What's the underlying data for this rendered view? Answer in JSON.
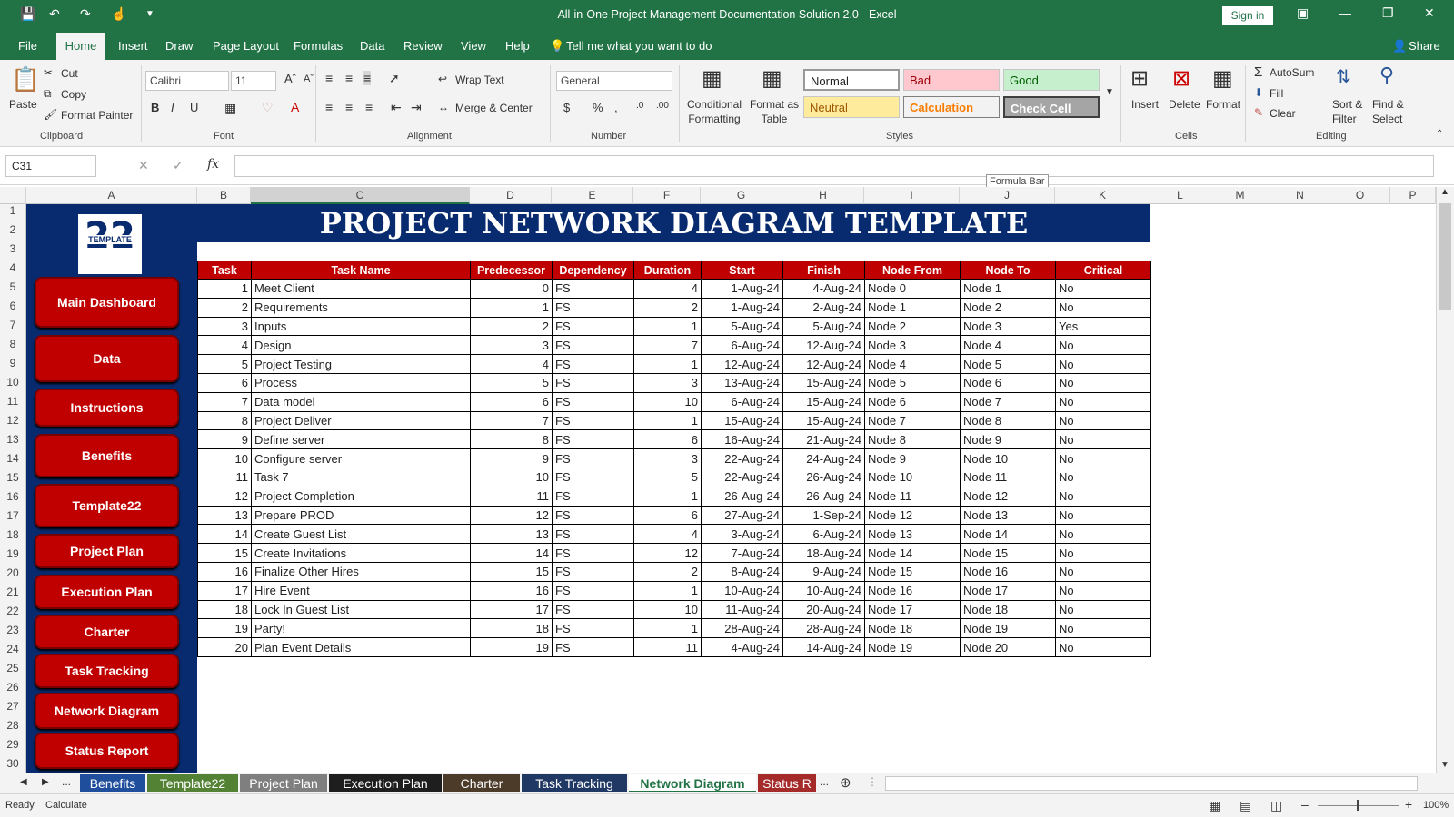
{
  "window": {
    "title": "All-in-One Project Management Documentation Solution 2.0  -  Excel",
    "sign_in": "Sign in"
  },
  "menu": {
    "tabs": [
      "File",
      "Home",
      "Insert",
      "Draw",
      "Page Layout",
      "Formulas",
      "Data",
      "Review",
      "View",
      "Help"
    ],
    "tell_me": "Tell me what you want to do",
    "share": "Share"
  },
  "ribbon": {
    "clipboard": {
      "paste": "Paste",
      "cut": "Cut",
      "copy": "Copy",
      "format_painter": "Format Painter",
      "label": "Clipboard"
    },
    "font": {
      "name": "Calibri",
      "size": "11",
      "label": "Font"
    },
    "alignment": {
      "wrap": "Wrap Text",
      "merge": "Merge & Center",
      "label": "Alignment"
    },
    "number": {
      "format": "General",
      "label": "Number"
    },
    "styles": {
      "conditional": "Conditional Formatting",
      "format_table": "Format as Table",
      "normal": "Normal",
      "bad": "Bad",
      "good": "Good",
      "neutral": "Neutral",
      "calculation": "Calculation",
      "check_cell": "Check Cell",
      "label": "Styles"
    },
    "cells": {
      "insert": "Insert",
      "delete": "Delete",
      "format": "Format",
      "label": "Cells"
    },
    "editing": {
      "autosum": "AutoSum",
      "fill": "Fill",
      "clear": "Clear",
      "sort": "Sort & Filter",
      "find": "Find & Select",
      "label": "Editing"
    }
  },
  "formula_bar": {
    "name_box": "C31",
    "tooltip": "Formula Bar"
  },
  "columns": [
    "A",
    "B",
    "C",
    "D",
    "E",
    "F",
    "G",
    "H",
    "I",
    "J",
    "K",
    "L",
    "M",
    "N",
    "O",
    "P"
  ],
  "rows": [
    "1",
    "2",
    "3",
    "4",
    "5",
    "6",
    "7",
    "8",
    "9",
    "10",
    "11",
    "12",
    "13",
    "14",
    "15",
    "16",
    "17",
    "18",
    "19",
    "20",
    "21",
    "22",
    "23",
    "24",
    "25",
    "26",
    "27",
    "28",
    "29",
    "30"
  ],
  "logo": {
    "number": "22",
    "text": "TEMPLATE"
  },
  "nav": [
    "Main Dashboard",
    "Data",
    "Instructions",
    "Benefits",
    "Template22",
    "Project Plan",
    "Execution Plan",
    "Charter",
    "Task Tracking",
    "Network Diagram",
    "Status Report"
  ],
  "banner": "PROJECT NETWORK DIAGRAM TEMPLATE",
  "table": {
    "headers": [
      "Task",
      "Task Name",
      "Predecessor",
      "Dependency",
      "Duration",
      "Start",
      "Finish",
      "Node From",
      "Node To",
      "Critical"
    ],
    "rows": [
      [
        "1",
        "Meet Client",
        "0",
        "FS",
        "4",
        "1-Aug-24",
        "4-Aug-24",
        "Node 0",
        "Node 1",
        "No"
      ],
      [
        "2",
        "Requirements",
        "1",
        "FS",
        "2",
        "1-Aug-24",
        "2-Aug-24",
        "Node 1",
        "Node 2",
        "No"
      ],
      [
        "3",
        "Inputs",
        "2",
        "FS",
        "1",
        "5-Aug-24",
        "5-Aug-24",
        "Node 2",
        "Node 3",
        "Yes"
      ],
      [
        "4",
        "Design",
        "3",
        "FS",
        "7",
        "6-Aug-24",
        "12-Aug-24",
        "Node 3",
        "Node 4",
        "No"
      ],
      [
        "5",
        "Project Testing",
        "4",
        "FS",
        "1",
        "12-Aug-24",
        "12-Aug-24",
        "Node 4",
        "Node 5",
        "No"
      ],
      [
        "6",
        "Process",
        "5",
        "FS",
        "3",
        "13-Aug-24",
        "15-Aug-24",
        "Node 5",
        "Node 6",
        "No"
      ],
      [
        "7",
        "Data model",
        "6",
        "FS",
        "10",
        "6-Aug-24",
        "15-Aug-24",
        "Node 6",
        "Node 7",
        "No"
      ],
      [
        "8",
        "Project Deliver",
        "7",
        "FS",
        "1",
        "15-Aug-24",
        "15-Aug-24",
        "Node 7",
        "Node 8",
        "No"
      ],
      [
        "9",
        "Define server",
        "8",
        "FS",
        "6",
        "16-Aug-24",
        "21-Aug-24",
        "Node 8",
        "Node 9",
        "No"
      ],
      [
        "10",
        "Configure server",
        "9",
        "FS",
        "3",
        "22-Aug-24",
        "24-Aug-24",
        "Node 9",
        "Node 10",
        "No"
      ],
      [
        "11",
        "Task 7",
        "10",
        "FS",
        "5",
        "22-Aug-24",
        "26-Aug-24",
        "Node 10",
        "Node 11",
        "No"
      ],
      [
        "12",
        "Project Completion",
        "11",
        "FS",
        "1",
        "26-Aug-24",
        "26-Aug-24",
        "Node 11",
        "Node 12",
        "No"
      ],
      [
        "13",
        "Prepare PROD",
        "12",
        "FS",
        "6",
        "27-Aug-24",
        "1-Sep-24",
        "Node 12",
        "Node 13",
        "No"
      ],
      [
        "14",
        "Create Guest List",
        "13",
        "FS",
        "4",
        "3-Aug-24",
        "6-Aug-24",
        "Node 13",
        "Node 14",
        "No"
      ],
      [
        "15",
        "Create Invitations",
        "14",
        "FS",
        "12",
        "7-Aug-24",
        "18-Aug-24",
        "Node 14",
        "Node 15",
        "No"
      ],
      [
        "16",
        "Finalize Other Hires",
        "15",
        "FS",
        "2",
        "8-Aug-24",
        "9-Aug-24",
        "Node 15",
        "Node 16",
        "No"
      ],
      [
        "17",
        "Hire Event",
        "16",
        "FS",
        "1",
        "10-Aug-24",
        "10-Aug-24",
        "Node 16",
        "Node 17",
        "No"
      ],
      [
        "18",
        "Lock In Guest List",
        "17",
        "FS",
        "10",
        "11-Aug-24",
        "20-Aug-24",
        "Node 17",
        "Node 18",
        "No"
      ],
      [
        "19",
        "Party!",
        "18",
        "FS",
        "1",
        "28-Aug-24",
        "28-Aug-24",
        "Node 18",
        "Node 19",
        "No"
      ],
      [
        "20",
        "Plan Event Details",
        "19",
        "FS",
        "11",
        "4-Aug-24",
        "14-Aug-24",
        "Node 19",
        "Node 20",
        "No"
      ]
    ]
  },
  "sheet_tabs": [
    {
      "label": "Benefits",
      "color": "#1f4e9c"
    },
    {
      "label": "Template22",
      "color": "#548235"
    },
    {
      "label": "Project Plan",
      "color": "#7f7f7f"
    },
    {
      "label": "Execution Plan",
      "color": "#1e1e1e"
    },
    {
      "label": "Charter",
      "color": "#4d3b2a"
    },
    {
      "label": "Task Tracking",
      "color": "#1f3864"
    },
    {
      "label": "Network Diagram",
      "color": "#ffffff"
    },
    {
      "label": "Status R",
      "color": "#a52a2a"
    }
  ],
  "status": {
    "ready": "Ready",
    "calculate": "Calculate",
    "zoom": "100%"
  },
  "colors": {
    "excel_green": "#217346",
    "navy": "#082a6e",
    "red": "#c00000"
  }
}
